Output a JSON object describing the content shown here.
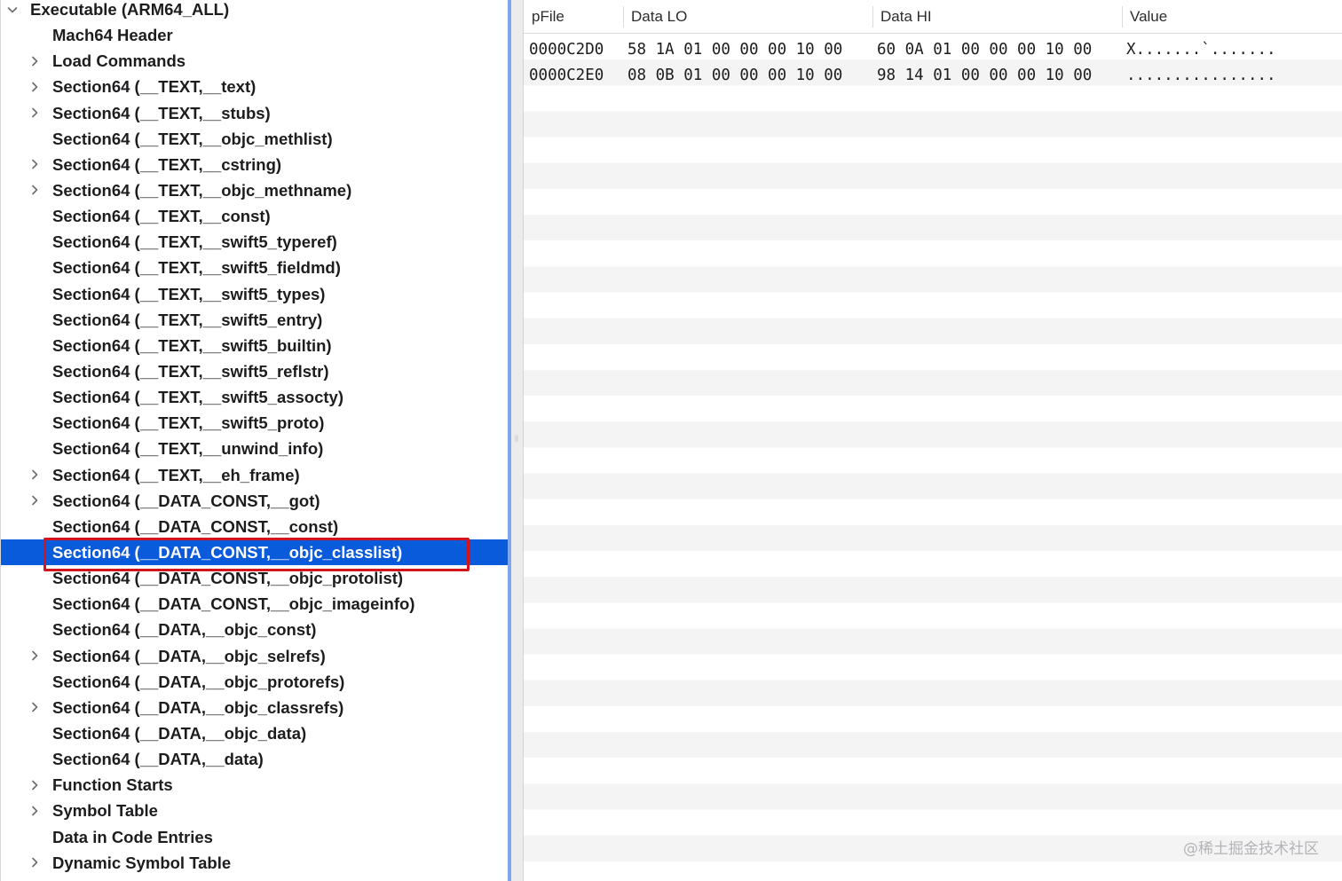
{
  "tree": {
    "items": [
      {
        "label": "Executable  (ARM64_ALL)",
        "depth": 0,
        "disclosure": "expanded"
      },
      {
        "label": "Mach64 Header",
        "depth": 1,
        "disclosure": "none"
      },
      {
        "label": "Load Commands",
        "depth": 1,
        "disclosure": "collapsed"
      },
      {
        "label": "Section64 (__TEXT,__text)",
        "depth": 1,
        "disclosure": "collapsed"
      },
      {
        "label": "Section64 (__TEXT,__stubs)",
        "depth": 1,
        "disclosure": "collapsed"
      },
      {
        "label": "Section64 (__TEXT,__objc_methlist)",
        "depth": 1,
        "disclosure": "none"
      },
      {
        "label": "Section64 (__TEXT,__cstring)",
        "depth": 1,
        "disclosure": "collapsed"
      },
      {
        "label": "Section64 (__TEXT,__objc_methname)",
        "depth": 1,
        "disclosure": "collapsed"
      },
      {
        "label": "Section64 (__TEXT,__const)",
        "depth": 1,
        "disclosure": "none"
      },
      {
        "label": "Section64 (__TEXT,__swift5_typeref)",
        "depth": 1,
        "disclosure": "none"
      },
      {
        "label": "Section64 (__TEXT,__swift5_fieldmd)",
        "depth": 1,
        "disclosure": "none"
      },
      {
        "label": "Section64 (__TEXT,__swift5_types)",
        "depth": 1,
        "disclosure": "none"
      },
      {
        "label": "Section64 (__TEXT,__swift5_entry)",
        "depth": 1,
        "disclosure": "none"
      },
      {
        "label": "Section64 (__TEXT,__swift5_builtin)",
        "depth": 1,
        "disclosure": "none"
      },
      {
        "label": "Section64 (__TEXT,__swift5_reflstr)",
        "depth": 1,
        "disclosure": "none"
      },
      {
        "label": "Section64 (__TEXT,__swift5_assocty)",
        "depth": 1,
        "disclosure": "none"
      },
      {
        "label": "Section64 (__TEXT,__swift5_proto)",
        "depth": 1,
        "disclosure": "none"
      },
      {
        "label": "Section64 (__TEXT,__unwind_info)",
        "depth": 1,
        "disclosure": "none"
      },
      {
        "label": "Section64 (__TEXT,__eh_frame)",
        "depth": 1,
        "disclosure": "collapsed"
      },
      {
        "label": "Section64 (__DATA_CONST,__got)",
        "depth": 1,
        "disclosure": "collapsed"
      },
      {
        "label": "Section64 (__DATA_CONST,__const)",
        "depth": 1,
        "disclosure": "none"
      },
      {
        "label": "Section64 (__DATA_CONST,__objc_classlist)",
        "depth": 1,
        "disclosure": "none",
        "selected": true
      },
      {
        "label": "Section64 (__DATA_CONST,__objc_protolist)",
        "depth": 1,
        "disclosure": "none"
      },
      {
        "label": "Section64 (__DATA_CONST,__objc_imageinfo)",
        "depth": 1,
        "disclosure": "none"
      },
      {
        "label": "Section64 (__DATA,__objc_const)",
        "depth": 1,
        "disclosure": "none"
      },
      {
        "label": "Section64 (__DATA,__objc_selrefs)",
        "depth": 1,
        "disclosure": "collapsed"
      },
      {
        "label": "Section64 (__DATA,__objc_protorefs)",
        "depth": 1,
        "disclosure": "none"
      },
      {
        "label": "Section64 (__DATA,__objc_classrefs)",
        "depth": 1,
        "disclosure": "collapsed"
      },
      {
        "label": "Section64 (__DATA,__objc_data)",
        "depth": 1,
        "disclosure": "none"
      },
      {
        "label": "Section64 (__DATA,__data)",
        "depth": 1,
        "disclosure": "none"
      },
      {
        "label": "Function Starts",
        "depth": 1,
        "disclosure": "collapsed"
      },
      {
        "label": "Symbol Table",
        "depth": 1,
        "disclosure": "collapsed"
      },
      {
        "label": "Data in Code Entries",
        "depth": 1,
        "disclosure": "none"
      },
      {
        "label": "Dynamic Symbol Table",
        "depth": 1,
        "disclosure": "collapsed"
      }
    ]
  },
  "table": {
    "headers": {
      "pfile": "pFile",
      "data_lo": "Data LO",
      "data_hi": "Data HI",
      "value": "Value"
    },
    "rows": [
      {
        "pfile": "0000C2D0",
        "data_lo": "58 1A 01 00 00 00 10 00",
        "data_hi": "60 0A 01 00 00 00 10 00",
        "value": "X.......`......."
      },
      {
        "pfile": "0000C2E0",
        "data_lo": "08 0B 01 00 00 00 10 00",
        "data_hi": "98 14 01 00 00 00 10 00",
        "value": "................"
      }
    ]
  },
  "watermark": "@稀土掘金技术社区",
  "colors": {
    "selection": "#0a5bdc",
    "highlight_border": "#d4141c",
    "text": "#1d1d1f",
    "stripe": "#f4f4f5"
  },
  "icons": {
    "expanded": "chevron-down-icon",
    "collapsed": "chevron-right-icon"
  }
}
